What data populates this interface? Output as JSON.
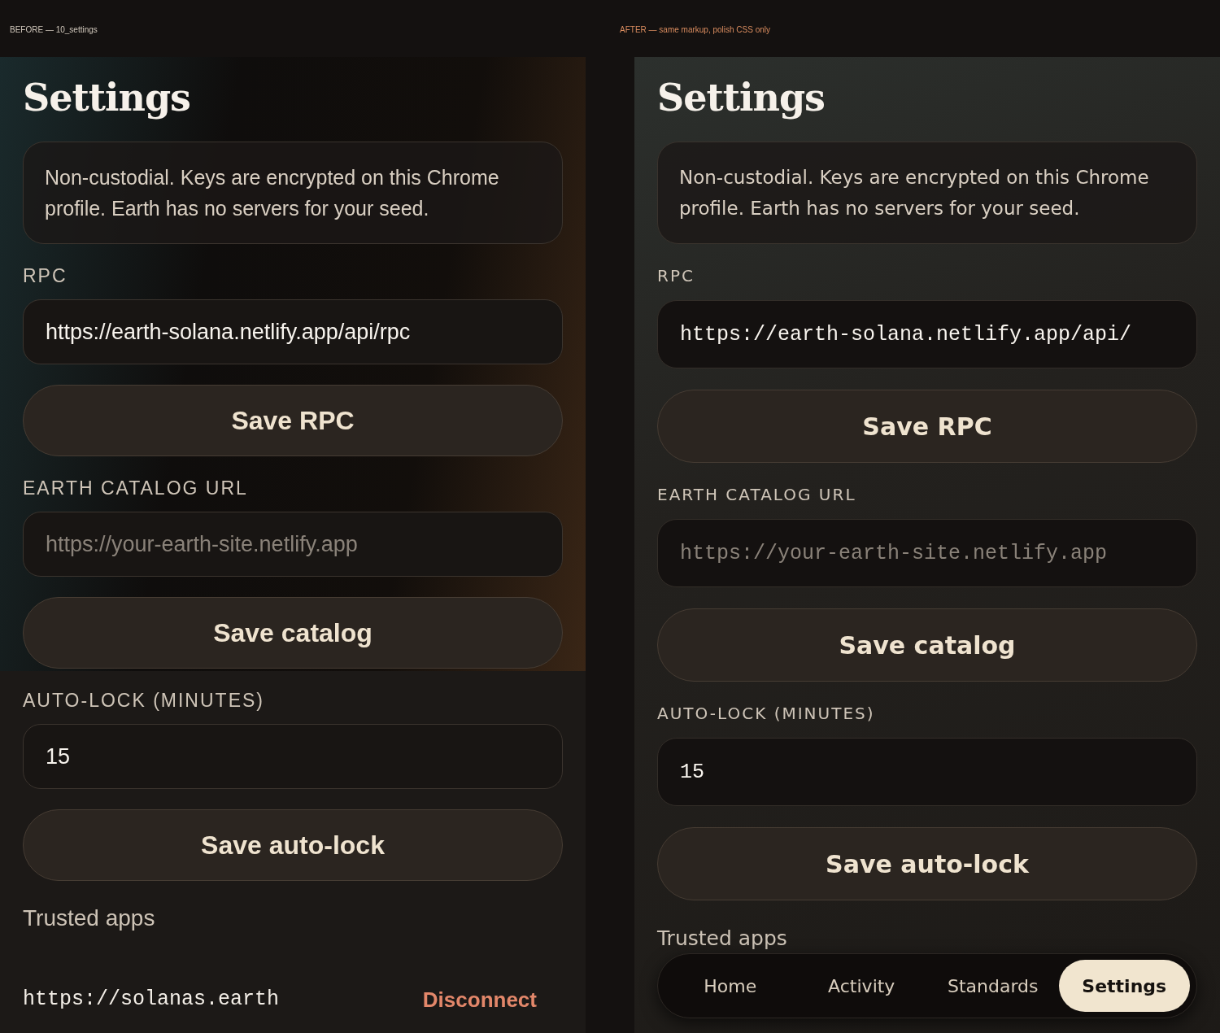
{
  "panels": [
    {
      "kind": "before",
      "caption": "BEFORE — 10_settings",
      "title": "Settings",
      "notice": "Non-custodial. Keys are encrypted on this Chrome profile. Earth has no servers for your seed.",
      "sections": [
        {
          "label": "RPC",
          "field": {
            "value": "https://earth-solana.netlify.app/api/rpc"
          },
          "button": "Save RPC"
        },
        {
          "label": "EARTH CATALOG URL",
          "field": {
            "placeholder": "https://your-earth-site.netlify.app"
          },
          "button": "Save catalog"
        },
        {
          "label": "AUTO-LOCK (MINUTES)",
          "field": {
            "value": "15"
          },
          "button": "Save auto-lock"
        }
      ],
      "trusted_heading": "Trusted apps",
      "apps": [
        {
          "url": "https://solanas.earth",
          "action": "Disconnect"
        }
      ]
    },
    {
      "kind": "after",
      "caption": "AFTER — same markup, polish CSS only",
      "title": "Settings",
      "notice": "Non-custodial. Keys are encrypted on this Chrome profile. Earth has no servers for your seed.",
      "sections": [
        {
          "label": "RPC",
          "field": {
            "value": "https://earth-solana.netlify.app/api/"
          },
          "button": "Save RPC"
        },
        {
          "label": "EARTH CATALOG URL",
          "field": {
            "placeholder": "https://your-earth-site.netlify.app"
          },
          "button": "Save catalog"
        },
        {
          "label": "AUTO-LOCK (MINUTES)",
          "field": {
            "value": "15"
          },
          "button": "Save auto-lock"
        }
      ],
      "trusted_heading": "Trusted apps",
      "nav": [
        {
          "label": "Home",
          "selected": false
        },
        {
          "label": "Activity",
          "selected": false
        },
        {
          "label": "Standards",
          "selected": false
        },
        {
          "label": "Settings",
          "selected": true
        }
      ]
    }
  ]
}
